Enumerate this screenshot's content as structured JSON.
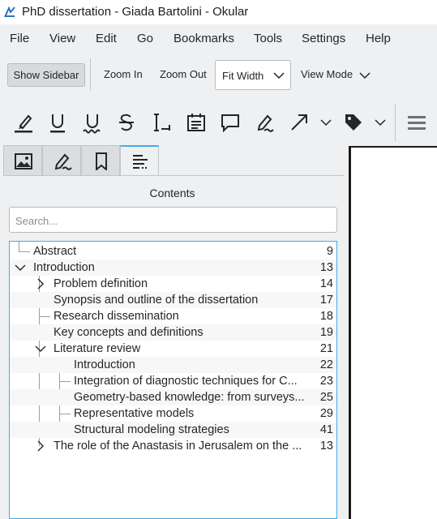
{
  "window": {
    "title": "PhD dissertation - Giada Bartolini  - Okular"
  },
  "menu": [
    "File",
    "View",
    "Edit",
    "Go",
    "Bookmarks",
    "Tools",
    "Settings",
    "Help"
  ],
  "toolbar": {
    "show_sidebar": "Show Sidebar",
    "zoom_in": "Zoom In",
    "zoom_out": "Zoom Out",
    "zoom_mode": "Fit Width",
    "view_mode": "View Mode"
  },
  "annotation_tools": [
    "highlighter-icon",
    "underline-icon",
    "squiggle-icon",
    "strikeout-icon",
    "typewriter-icon",
    "note-icon",
    "comment-icon",
    "freehand-icon",
    "arrow-icon",
    "stamp-icon",
    "menu-icon"
  ],
  "sidebar": {
    "tabs": [
      "thumbnails-icon",
      "annotations-icon",
      "bookmarks-icon",
      "contents-icon"
    ],
    "active_tab": "contents-icon",
    "title": "Contents",
    "search_placeholder": "Search..."
  },
  "toc": [
    {
      "label": "Abstract",
      "page": "9",
      "level": 0,
      "expander": "none"
    },
    {
      "label": "Introduction",
      "page": "13",
      "level": 0,
      "expander": "expanded"
    },
    {
      "label": "Problem definition",
      "page": "14",
      "level": 1,
      "expander": "collapsed"
    },
    {
      "label": "Synopsis and outline of the dissertation",
      "page": "17",
      "level": 1,
      "expander": "none"
    },
    {
      "label": "Research dissemination",
      "page": "18",
      "level": 1,
      "expander": "none"
    },
    {
      "label": "Key concepts and definitions",
      "page": "19",
      "level": 1,
      "expander": "none"
    },
    {
      "label": "Literature review",
      "page": "21",
      "level": 1,
      "expander": "expanded"
    },
    {
      "label": "Introduction",
      "page": "22",
      "level": 2,
      "expander": "none"
    },
    {
      "label": "Integration of diagnostic techniques for C...",
      "page": "23",
      "level": 2,
      "expander": "none"
    },
    {
      "label": "Geometry-based knowledge: from surveys...",
      "page": "25",
      "level": 2,
      "expander": "none"
    },
    {
      "label": "Representative models",
      "page": "29",
      "level": 2,
      "expander": "none"
    },
    {
      "label": "Structural modeling strategies",
      "page": "41",
      "level": 2,
      "expander": "none"
    },
    {
      "label": "The role of the Anastasis in Jerusalem on the ...",
      "page": "13",
      "level": 1,
      "expander": "collapsed"
    }
  ],
  "colors": {
    "accent": "#3daee9",
    "background": "#eff0f1",
    "text": "#232629"
  }
}
